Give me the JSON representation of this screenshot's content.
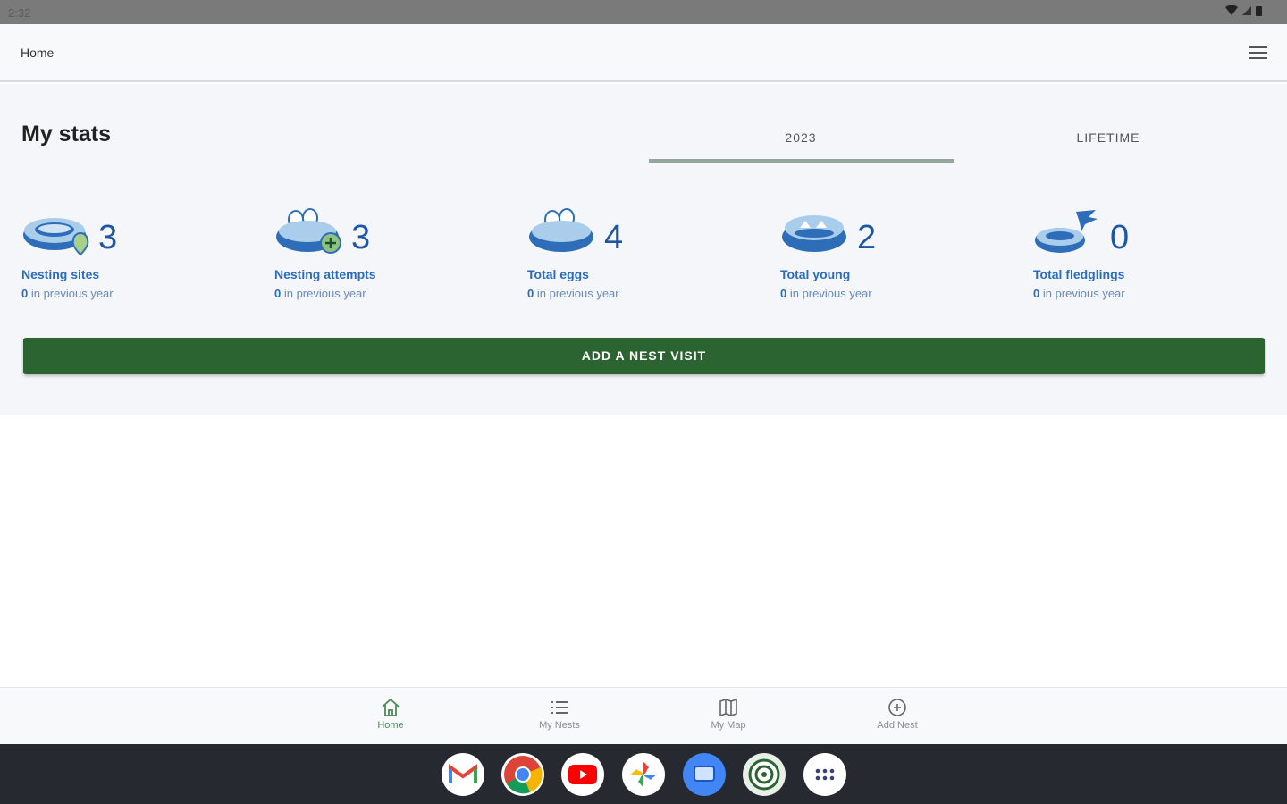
{
  "status_bar": {
    "time": "2:32"
  },
  "app_bar": {
    "title": "Home",
    "menu_icon": "hamburger-menu-icon"
  },
  "stats": {
    "title": "My stats",
    "tabs": [
      {
        "label": "2023",
        "selected": true
      },
      {
        "label": "LIFETIME",
        "selected": false
      }
    ],
    "items": [
      {
        "value": "3",
        "label": "Nesting sites",
        "prev_count": "0",
        "prev_text": " in previous year",
        "icon": "nest-location-icon"
      },
      {
        "value": "3",
        "label": "Nesting attempts",
        "prev_count": "0",
        "prev_text": " in previous year",
        "icon": "nest-add-icon"
      },
      {
        "value": "4",
        "label": "Total eggs",
        "prev_count": "0",
        "prev_text": " in previous year",
        "icon": "nest-eggs-icon"
      },
      {
        "value": "2",
        "label": "Total young",
        "prev_count": "0",
        "prev_text": " in previous year",
        "icon": "nest-young-icon"
      },
      {
        "value": "0",
        "label": "Total fledglings",
        "prev_count": "0",
        "prev_text": " in previous year",
        "icon": "nest-fledgling-icon"
      }
    ],
    "action_label": "ADD A NEST VISIT"
  },
  "bottom_nav": {
    "items": [
      {
        "label": "Home",
        "icon": "home-icon",
        "active": true
      },
      {
        "label": "My Nests",
        "icon": "list-icon",
        "active": false
      },
      {
        "label": "My Map",
        "icon": "map-icon",
        "active": false
      },
      {
        "label": "Add Nest",
        "icon": "add-circle-icon",
        "active": false
      }
    ]
  },
  "taskbar": {
    "apps": [
      "gmail-icon",
      "chrome-icon",
      "youtube-icon",
      "photos-icon",
      "messages-icon",
      "nestwatch-icon",
      "app-drawer-icon"
    ]
  },
  "colors": {
    "accent_green": "#2b6431",
    "stat_blue": "#1d57a4",
    "tab_indicator": "#93a89a"
  }
}
